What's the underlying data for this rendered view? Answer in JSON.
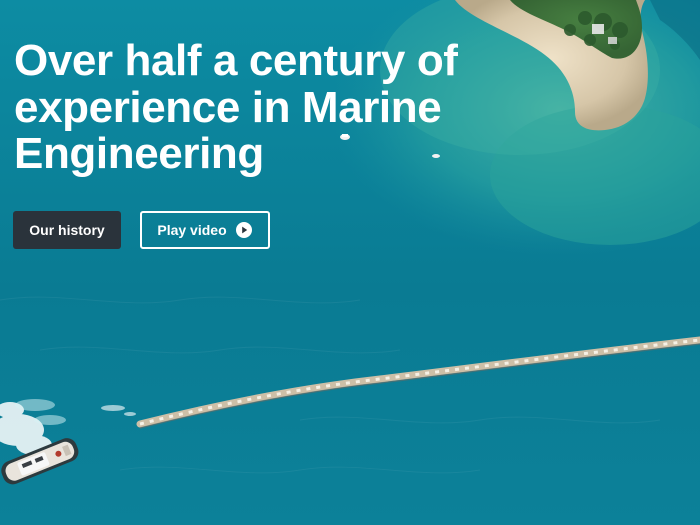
{
  "hero": {
    "headline": "Over half a century of experience in Marine Engineering",
    "buttons": {
      "primary_label": "Our history",
      "secondary_label": "Play video"
    },
    "icons": {
      "play": "play-circle-icon"
    }
  }
}
